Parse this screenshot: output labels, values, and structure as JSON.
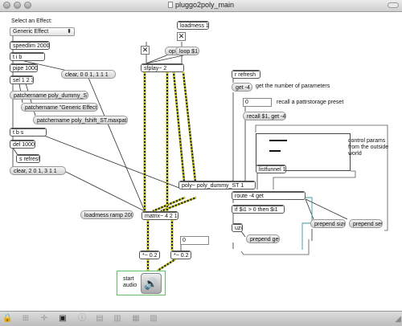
{
  "window": {
    "title": "pluggo2poly_main"
  },
  "menu": {
    "label": "Select an Effect:",
    "selected": "Generic Effect"
  },
  "objects": {
    "speedlim": "speedlim 2000",
    "tb": "t i b",
    "pipe": "pipe 1000",
    "sel": "sel 1 2 3",
    "tbs": "t b s",
    "del": "del 1000",
    "sfplay": "sfplay~ 2",
    "poly": "poly~ poly_dummy_ST 1",
    "matrix": "matrix~ 4 2 1.",
    "mul_left": "*~ 0.2",
    "mul_right": "*~ 0.2",
    "listfunnel": "listfunnel 1",
    "route": "route -4 get",
    "if": "if $i1 > 0 then $i1",
    "uzi": "uzi"
  },
  "messages": {
    "clear1": "clear, 0 0 1, 1 1 1",
    "pm_dummy": "patchername poly_dummy_ST.maxpat",
    "pm_generic": "patchername \"Generic Effect.maxpat\"",
    "pm_fshift": "patchername poly_fshift_ST.maxpat",
    "srefresh": "s refresh",
    "clear2": "clear, 2 0 1, 3 1 1",
    "loadmess_ramp": "loadmess ramp 2000",
    "open": "open",
    "loadmess1": "loadmess 1",
    "loop": "loop $1",
    "rrefresh": "r refresh",
    "get4": "get -4",
    "recall": "recall $1, get -4",
    "prepend_size": "prepend size",
    "prepend_set": "prepend set",
    "prepend_get": "prepend get"
  },
  "numbers": {
    "num_a": "0",
    "num_b": "0"
  },
  "comments": {
    "getnum": "get the number of parameters",
    "recall_preset": "recall a pattrstorage preset",
    "control_params": "control params\nfrom the outside\nworld",
    "start_audio": "start\naudio"
  },
  "toggles": {
    "toggle_sfplay": "✕",
    "toggle_loop": "✕"
  },
  "icons": {
    "lock": "lock-icon",
    "new_object": "new-object-icon",
    "new_message": "new-message-icon",
    "comment": "comment-icon",
    "inspector": "inspector-icon",
    "speaker": "speaker-icon"
  }
}
